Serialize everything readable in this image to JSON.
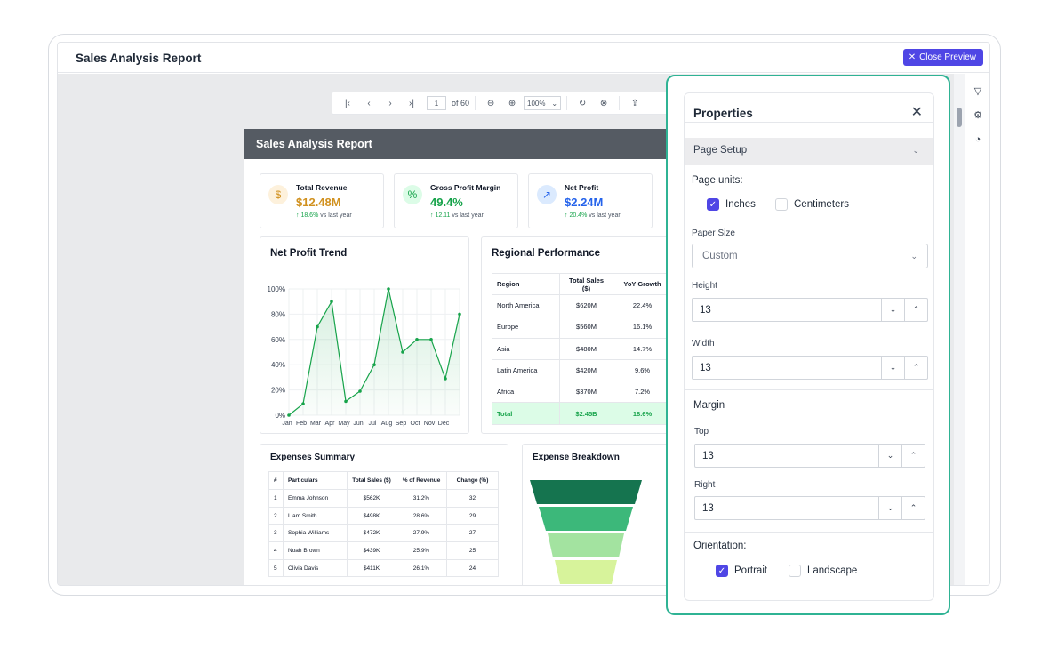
{
  "window": {
    "title": "Sales Analysis Report",
    "close_preview_label": "Close Preview"
  },
  "toolbar": {
    "page_value": "1",
    "page_total": "of 60",
    "zoom": "100%"
  },
  "report": {
    "title": "Sales Analysis Report",
    "kpis": [
      {
        "label": "Total Revenue",
        "value": "$12.48M",
        "change": "18.6%",
        "suffix": "vs last year",
        "color": "#d1911f",
        "icon": "dollar-icon"
      },
      {
        "label": "Gross Profit Margin",
        "value": "49.4%",
        "change": "12.11",
        "suffix": "vs last year",
        "color": "#16a34a",
        "icon": "percent-icon"
      },
      {
        "label": "Net Profit",
        "value": "$2.24M",
        "change": "20.4%",
        "suffix": "vs last year",
        "color": "#2563eb",
        "icon": "trend-up-icon"
      }
    ],
    "net_profit_title": "Net Profit Trend",
    "regional_title": "Regional Performance",
    "regional_table": {
      "headers": [
        "Region",
        "Total Sales ($)",
        "YoY Growth"
      ],
      "rows": [
        [
          "North America",
          "$620M",
          "22.4%"
        ],
        [
          "Europe",
          "$560M",
          "16.1%"
        ],
        [
          "Asia",
          "$480M",
          "14.7%"
        ],
        [
          "Latin America",
          "$420M",
          "9.6%"
        ],
        [
          "Africa",
          "$370M",
          "7.2%"
        ]
      ],
      "total": [
        "Total",
        "$2.45B",
        "18.6%"
      ]
    },
    "expenses_title": "Expenses Summary",
    "expenses_table": {
      "headers": [
        "#",
        "Particulars",
        "Total Sales ($)",
        "% of Revenue",
        "Change (%)"
      ],
      "rows": [
        [
          "1",
          "Emma Johnson",
          "$562K",
          "31.2%",
          "32"
        ],
        [
          "2",
          "Liam Smith",
          "$498K",
          "28.6%",
          "29"
        ],
        [
          "3",
          "Sophia Williams",
          "$472K",
          "27.9%",
          "27"
        ],
        [
          "4",
          "Noah Brown",
          "$439K",
          "25.9%",
          "25"
        ],
        [
          "5",
          "Olivia Davis",
          "$411K",
          "26.1%",
          "24"
        ]
      ]
    },
    "breakdown_title": "Expense Breakdown"
  },
  "chart_data": {
    "type": "line",
    "categories": [
      "Jan",
      "Feb",
      "Mar",
      "Apr",
      "May",
      "Jun",
      "Jul",
      "Aug",
      "Sep",
      "Oct",
      "Nov",
      "Dec"
    ],
    "values": [
      0,
      9,
      70,
      90,
      11,
      19,
      40,
      100,
      50,
      60,
      60,
      29,
      80
    ],
    "x_index": [
      0,
      1,
      2,
      3,
      4,
      5,
      6,
      7,
      8,
      9,
      10,
      11,
      12
    ],
    "y_ticks": [
      "100%",
      "80%",
      "60%",
      "40%",
      "20%",
      "0%"
    ],
    "ylim": [
      0,
      100
    ],
    "grid": true,
    "color": "#16a34a"
  },
  "properties": {
    "title": "Properties",
    "section": "Page Setup",
    "page_units_label": "Page units:",
    "unit_inches": "Inches",
    "unit_cm": "Centimeters",
    "paper_size_label": "Paper Size",
    "paper_size_value": "Custom",
    "height_label": "Height",
    "height_value": "13",
    "width_label": "Width",
    "width_value": "13",
    "margin_label": "Margin",
    "top_label": "Top",
    "top_value": "13",
    "right_label": "Right",
    "right_value": "13",
    "orientation_label": "Orientation:",
    "portrait": "Portrait",
    "landscape": "Landscape"
  }
}
